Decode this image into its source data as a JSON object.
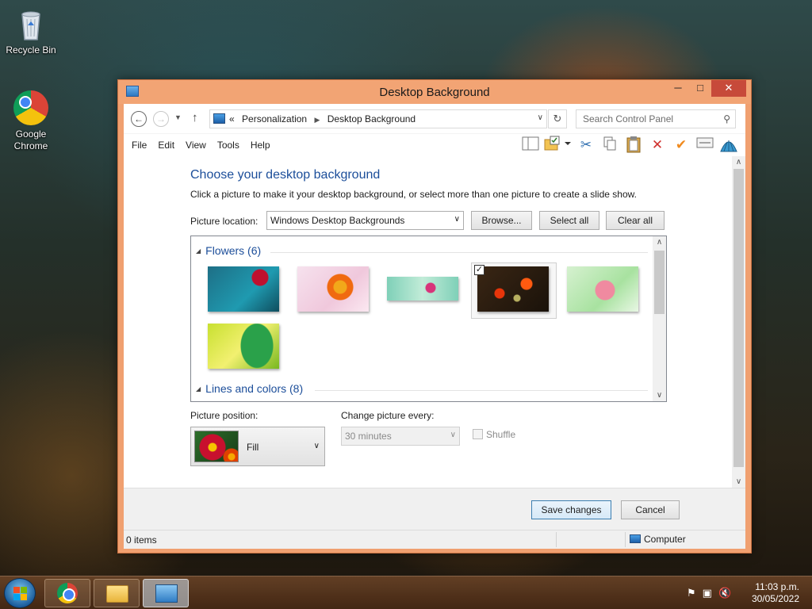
{
  "desktop": {
    "icons": [
      {
        "label": "Recycle Bin",
        "icon": "recycle-bin-icon"
      },
      {
        "label": "Google\nChrome",
        "icon": "chrome-icon"
      }
    ]
  },
  "window": {
    "title": "Desktop Background",
    "controls": {
      "minimize": "─",
      "maximize": "□",
      "close": "✕"
    }
  },
  "address_bar": {
    "overflow": "«",
    "crumbs": [
      "Personalization",
      "Desktop Background"
    ],
    "search_placeholder": "Search Control Panel"
  },
  "menu": [
    "File",
    "Edit",
    "View",
    "Tools",
    "Help"
  ],
  "toolbar_icons": [
    "pane-icon",
    "folder-properties-icon",
    "cut-icon",
    "copy-icon",
    "paste-icon",
    "delete-icon",
    "checkmark-icon",
    "card-icon",
    "shell-icon"
  ],
  "main": {
    "heading": "Choose your desktop background",
    "instructions": "Click a picture to make it your desktop background, or select more than one picture to create a slide show.",
    "picture_location_label": "Picture location:",
    "picture_location_value": "Windows Desktop Backgrounds",
    "browse_label": "Browse...",
    "select_all_label": "Select all",
    "clear_all_label": "Clear all",
    "groups": [
      {
        "name": "Flowers (6)",
        "thumbnails": 6,
        "selected_index": 3
      },
      {
        "name": "Lines and colors (8)"
      }
    ],
    "picture_position_label": "Picture position:",
    "picture_position_value": "Fill",
    "change_every_label": "Change picture every:",
    "change_every_value": "30 minutes",
    "shuffle_label": "Shuffle",
    "shuffle_checked": false
  },
  "footer": {
    "save_label": "Save changes",
    "cancel_label": "Cancel"
  },
  "status": {
    "items": "0 items",
    "location": "Computer"
  },
  "taskbar": {
    "apps": [
      "chrome-icon",
      "file-explorer-icon",
      "control-panel-icon"
    ],
    "active_app": "control-panel-icon",
    "time": "11:03 p.m.",
    "date": "30/05/2022"
  }
}
